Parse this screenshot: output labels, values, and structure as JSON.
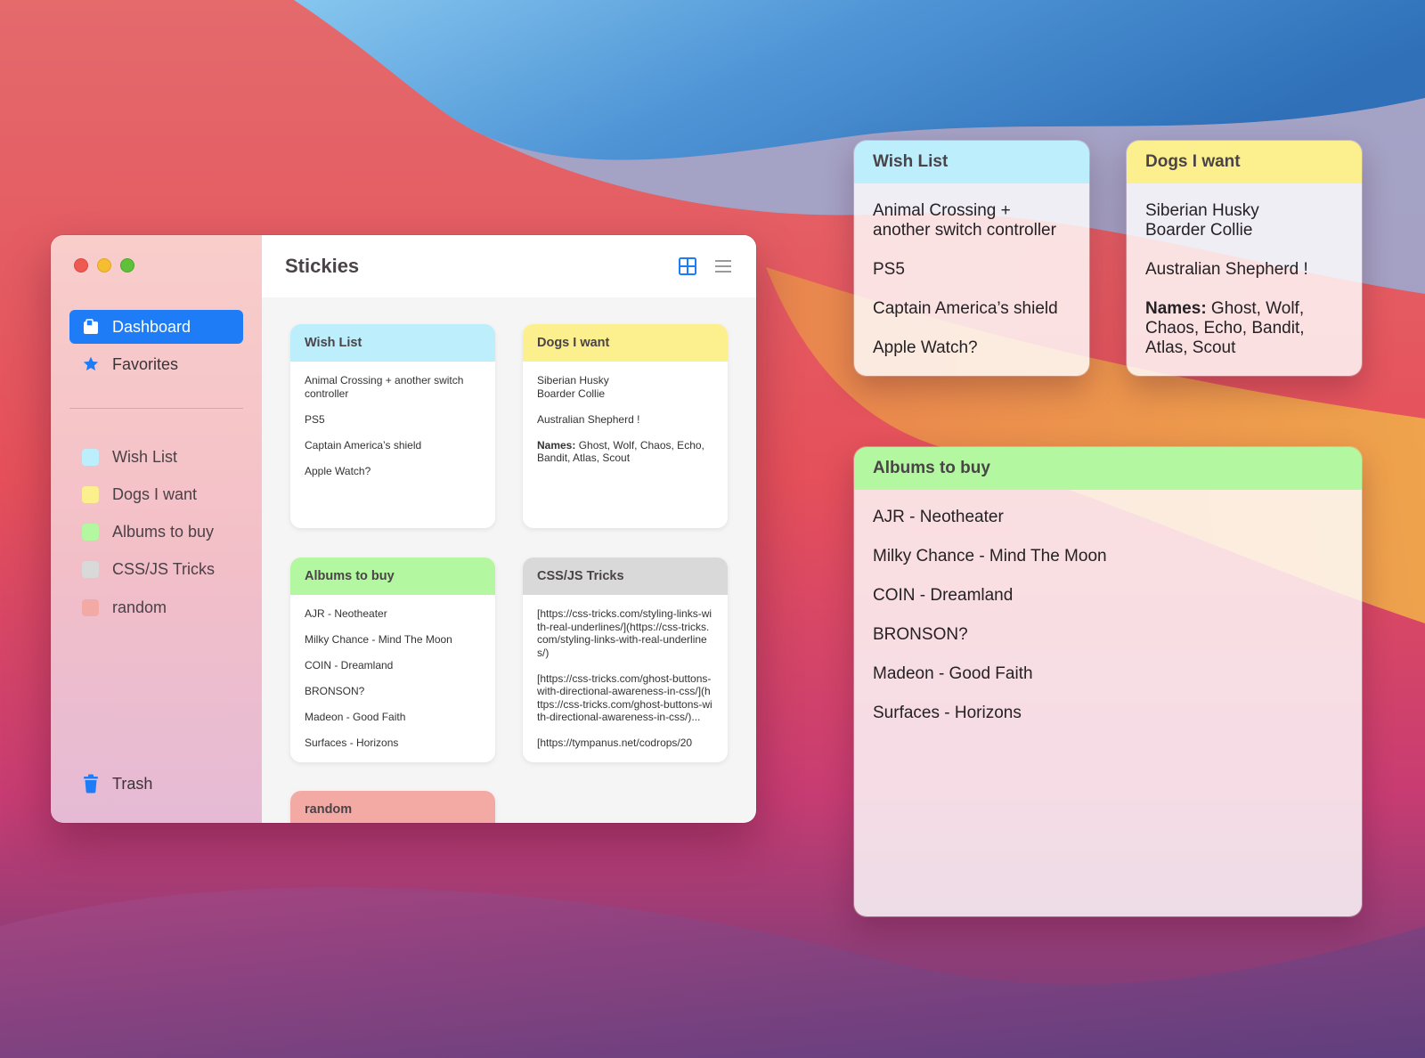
{
  "app": {
    "title": "Stickies"
  },
  "sidebar": {
    "nav": [
      {
        "label": "Dashboard",
        "icon": "dashboard-icon",
        "active": true
      },
      {
        "label": "Favorites",
        "icon": "star-icon",
        "active": false
      }
    ],
    "notes": [
      {
        "label": "Wish List",
        "color": "#bdeefb"
      },
      {
        "label": "Dogs I want",
        "color": "#fcef8e"
      },
      {
        "label": "Albums to buy",
        "color": "#b3f7a0"
      },
      {
        "label": "CSS/JS Tricks",
        "color": "#d9d9d9"
      },
      {
        "label": "random",
        "color": "#f3aaa5"
      }
    ],
    "trash": "Trash"
  },
  "toolbar": {
    "grid_icon": "grid-view-icon",
    "list_icon": "list-view-icon"
  },
  "notes": {
    "wish": {
      "title": "Wish List",
      "items": [
        "Animal Crossing + another switch controller",
        "PS5",
        "Captain America’s shield",
        "Apple Watch?"
      ]
    },
    "dogs": {
      "title": "Dogs I want",
      "line1": "Siberian Husky",
      "line2": "Boarder Collie",
      "line3": "Australian Shepherd !",
      "names_label": "Names:",
      "names_value": " Ghost, Wolf, Chaos, Echo, Bandit, Atlas, Scout"
    },
    "albums": {
      "title": "Albums to buy",
      "items": [
        "AJR - Neotheater",
        "Milky Chance - Mind The Moon",
        "COIN - Dreamland",
        "BRONSON?",
        "Madeon - Good Faith",
        "Surfaces - Horizons"
      ]
    },
    "css": {
      "title": "CSS/JS Tricks",
      "items": [
        "[https://css-tricks.com/styling-links-with-real-underlines/](https://css-tricks.com/styling-links-with-real-underlines/)",
        "[https://css-tricks.com/ghost-buttons-with-directional-awareness-in-css/](https://css-tricks.com/ghost-buttons-with-directional-awareness-in-css/)...",
        "[https://tympanus.net/codrops/20"
      ]
    },
    "random": {
      "title": "random"
    }
  },
  "colors": {
    "accent": "#1e7cf6",
    "wish": "#bdeefb",
    "dogs": "#fcef8e",
    "albums": "#b3f7a0",
    "css": "#d9d9d9",
    "random": "#f3aaa5"
  }
}
